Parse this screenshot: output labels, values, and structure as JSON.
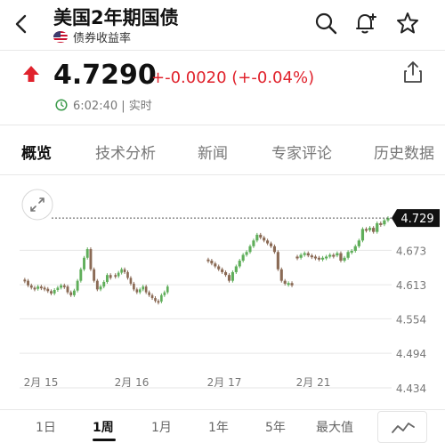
{
  "header": {
    "title": "美国2年期国债",
    "subtitle": "债券收益率"
  },
  "quote": {
    "price": "4.7290",
    "change": "+-0.0020 (+-0.04%)",
    "time": "6:02:40 | 实时",
    "change_color": "#e0222c"
  },
  "tabs": [
    {
      "label": "概览",
      "active": true
    },
    {
      "label": "技术分析",
      "active": false
    },
    {
      "label": "新闻",
      "active": false
    },
    {
      "label": "专家评论",
      "active": false
    },
    {
      "label": "历史数据",
      "active": false
    }
  ],
  "ranges": [
    {
      "label": "1日",
      "active": false
    },
    {
      "label": "1周",
      "active": true
    },
    {
      "label": "1月",
      "active": false
    },
    {
      "label": "1年",
      "active": false
    },
    {
      "label": "5年",
      "active": false
    },
    {
      "label": "最大值",
      "active": false
    }
  ],
  "chart_data": {
    "type": "candlestick",
    "title": "",
    "xlabel": "",
    "ylabel": "",
    "y_ticks": [
      "4.673",
      "4.613",
      "4.554",
      "4.494",
      "4.434"
    ],
    "x_ticks": [
      "2月 15",
      "2月 16",
      "2月 17",
      "2月 21"
    ],
    "ylim": [
      4.434,
      4.74
    ],
    "last_price_label": "4.729",
    "up_color": "#5fae5a",
    "down_color": "#8a6a55",
    "sessions": [
      {
        "x_tick": "2月 15",
        "closes": [
          4.62,
          4.612,
          4.608,
          4.606,
          4.61,
          4.608,
          4.606,
          4.602,
          4.598,
          4.604,
          4.608,
          4.612,
          4.61,
          4.6,
          4.595,
          4.603,
          4.62,
          4.64,
          4.66,
          4.675,
          4.64,
          4.62,
          4.605,
          4.61,
          4.618,
          4.63,
          4.625
        ]
      },
      {
        "x_tick": "2月 16",
        "closes": [
          4.628,
          4.634,
          4.64,
          4.635,
          4.625,
          4.615,
          4.605,
          4.6,
          4.605,
          4.61,
          4.6,
          4.595,
          4.59,
          4.585,
          4.584,
          4.595,
          4.6,
          4.61
        ]
      },
      {
        "x_tick": "2月 17",
        "closes": [
          4.655,
          4.65,
          4.645,
          4.64,
          4.635,
          4.63,
          4.62,
          4.635,
          4.645,
          4.655,
          4.665,
          4.67,
          4.68,
          4.69,
          4.7,
          4.695,
          4.69,
          4.685,
          4.68,
          4.67,
          4.64,
          4.62,
          4.615,
          4.616,
          4.612
        ]
      },
      {
        "x_tick": "2月 21",
        "closes": [
          4.66,
          4.665,
          4.668,
          4.664,
          4.662,
          4.66,
          4.658,
          4.66,
          4.662,
          4.665,
          4.664,
          4.668,
          4.655,
          4.66,
          4.67,
          4.672,
          4.68,
          4.69,
          4.71,
          4.708,
          4.712,
          4.705,
          4.72,
          4.718,
          4.725,
          4.729
        ]
      }
    ]
  }
}
